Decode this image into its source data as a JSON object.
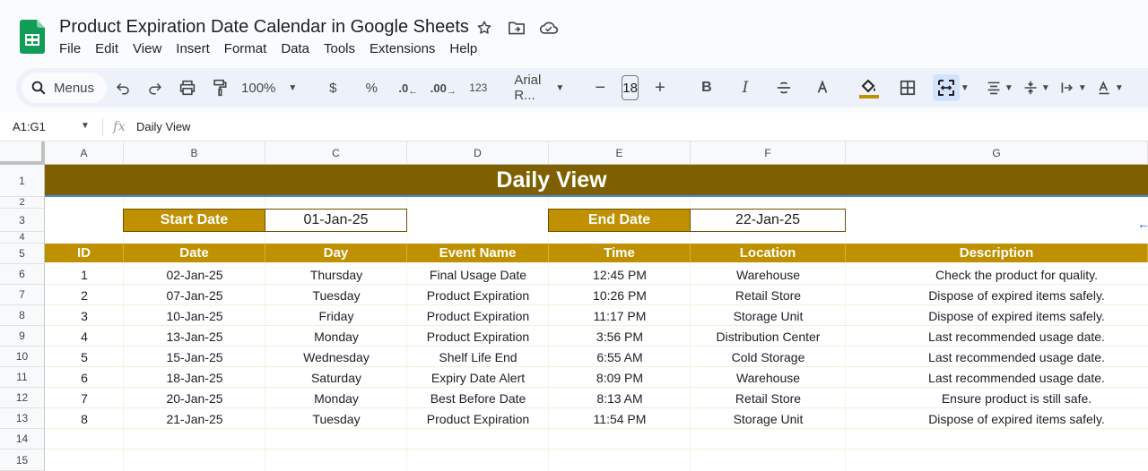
{
  "app": {
    "title": "Product Expiration Date Calendar in Google Sheets",
    "menus": [
      "File",
      "Edit",
      "View",
      "Insert",
      "Format",
      "Data",
      "Tools",
      "Extensions",
      "Help"
    ]
  },
  "toolbar": {
    "search_label": "Menus",
    "zoom": "100%",
    "currency": "$",
    "percent": "%",
    "dec_decrease": ".0",
    "dec_increase": ".00",
    "number_format": "123",
    "font": "Arial R...",
    "font_size": "18"
  },
  "formula_bar": {
    "name_box": "A1:G1",
    "content": "Daily View"
  },
  "columns": [
    "A",
    "B",
    "C",
    "D",
    "E",
    "F",
    "G"
  ],
  "rows": [
    "1",
    "2",
    "3",
    "4",
    "5",
    "6",
    "7",
    "8",
    "9",
    "10",
    "11",
    "12",
    "13",
    "14",
    "15"
  ],
  "sheet": {
    "banner": "Daily View",
    "start_label": "Start Date",
    "start_value": "01-Jan-25",
    "end_label": "End Date",
    "end_value": "22-Jan-25",
    "headers": [
      "ID",
      "Date",
      "Day",
      "Event Name",
      "Time",
      "Location",
      "Description"
    ],
    "records": [
      [
        "1",
        "02-Jan-25",
        "Thursday",
        "Final Usage Date",
        "12:45 PM",
        "Warehouse",
        "Check the product for quality."
      ],
      [
        "2",
        "07-Jan-25",
        "Tuesday",
        "Product Expiration",
        "10:26 PM",
        "Retail Store",
        "Dispose of expired items safely."
      ],
      [
        "3",
        "10-Jan-25",
        "Friday",
        "Product Expiration",
        "11:17 PM",
        "Storage Unit",
        "Dispose of expired items safely."
      ],
      [
        "4",
        "13-Jan-25",
        "Monday",
        "Product Expiration",
        "3:56 PM",
        "Distribution Center",
        "Last recommended usage date."
      ],
      [
        "5",
        "15-Jan-25",
        "Wednesday",
        "Shelf Life End",
        "6:55 AM",
        "Cold Storage",
        "Last recommended usage date."
      ],
      [
        "6",
        "18-Jan-25",
        "Saturday",
        "Expiry Date Alert",
        "8:09 PM",
        "Warehouse",
        "Last recommended usage date."
      ],
      [
        "7",
        "20-Jan-25",
        "Monday",
        "Best Before Date",
        "8:13 AM",
        "Retail Store",
        "Ensure product is still safe."
      ],
      [
        "8",
        "21-Jan-25",
        "Tuesday",
        "Product Expiration",
        "11:54 PM",
        "Storage Unit",
        "Dispose of expired items safely."
      ]
    ]
  },
  "colors": {
    "banner": "#7f6000",
    "header": "#bf9000",
    "sheets_green": "#0f9d58"
  }
}
